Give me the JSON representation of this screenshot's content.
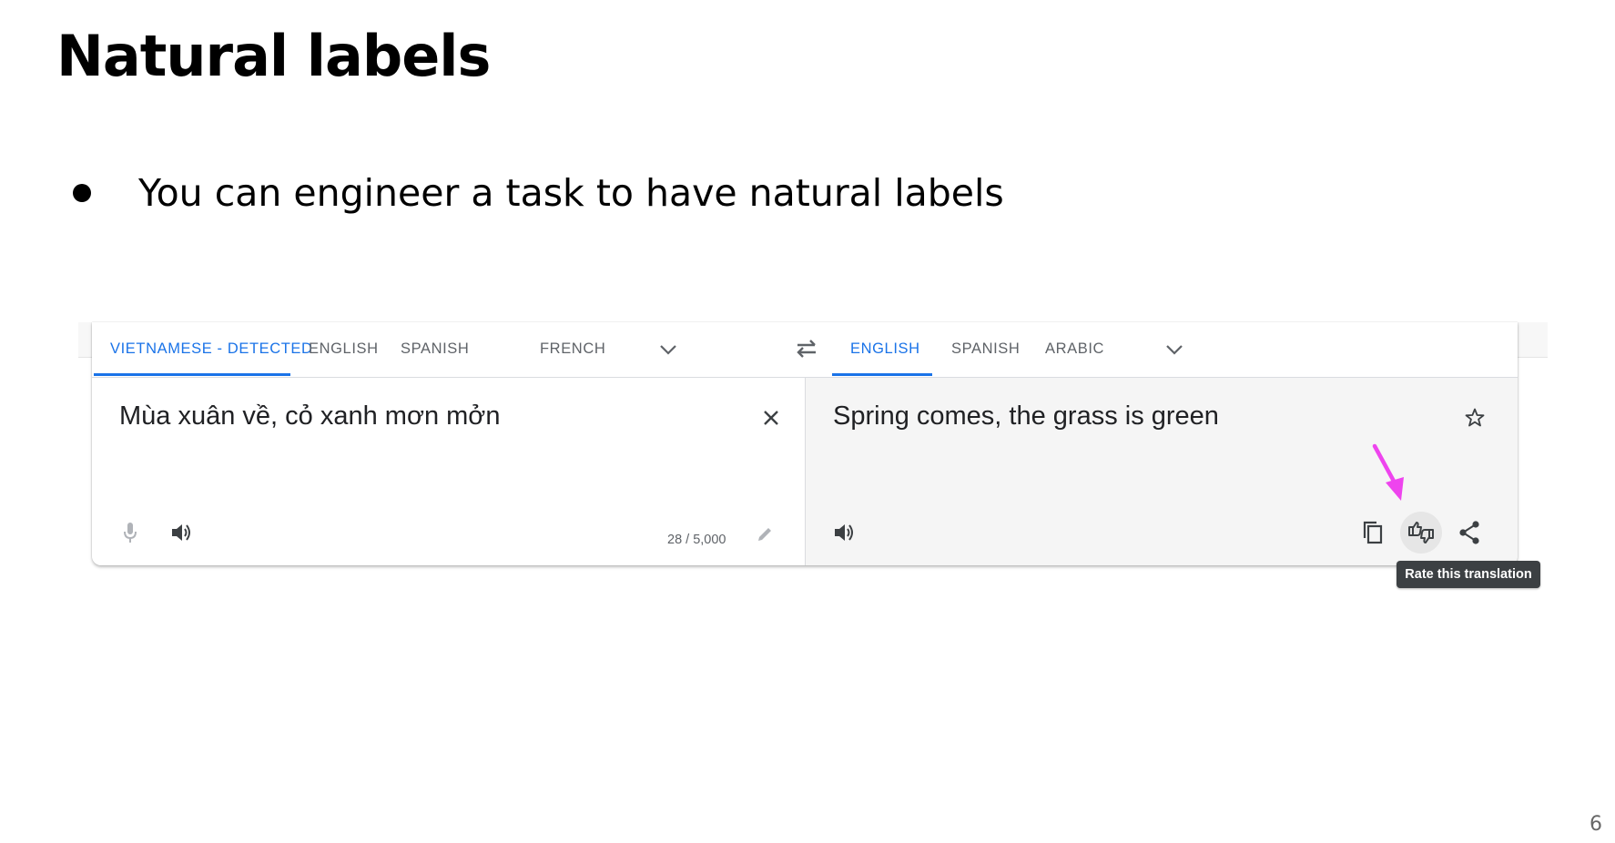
{
  "slide": {
    "title": "Natural labels",
    "bullet": "You can engineer a task to have natural labels",
    "page_number": "6"
  },
  "translate": {
    "source_tabs": [
      {
        "label": "VIETNAMESE - DETECTED",
        "active": true
      },
      {
        "label": "ENGLISH",
        "active": false
      },
      {
        "label": "SPANISH",
        "active": false
      },
      {
        "label": "FRENCH",
        "active": false
      }
    ],
    "target_tabs": [
      {
        "label": "ENGLISH",
        "active": true
      },
      {
        "label": "SPANISH",
        "active": false
      },
      {
        "label": "ARABIC",
        "active": false
      }
    ],
    "source_text": "Mùa xuân về, cỏ xanh mơn mởn",
    "target_text": "Spring comes, the grass is green",
    "char_count": "28 / 5,000",
    "tooltip": "Rate this translation",
    "icons": {
      "source_lang_dropdown": "chevron-down-icon",
      "swap": "swap-languages-icon",
      "target_lang_dropdown": "chevron-down-icon",
      "clear": "close-icon",
      "microphone": "microphone-icon",
      "listen_source": "speaker-icon",
      "edit": "pencil-icon",
      "star": "star-outline-icon",
      "listen_target": "speaker-icon",
      "copy": "copy-icon",
      "rate": "thumbs-up-down-icon",
      "share": "share-icon"
    },
    "colors": {
      "accent": "#1a73e8",
      "tab_text": "#5f6368",
      "annotation_arrow": "#ee44ee",
      "tooltip_bg": "#3c4043"
    }
  }
}
